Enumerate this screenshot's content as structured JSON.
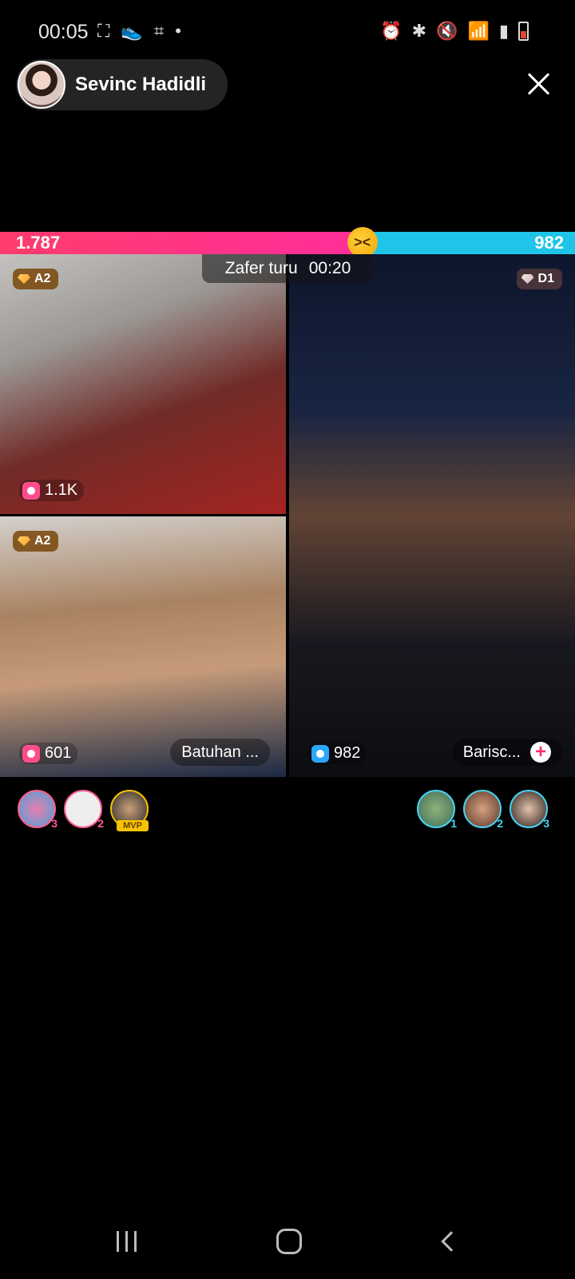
{
  "status_bar": {
    "time": "00:05",
    "left_icons": [
      "screenshot-icon",
      "shoe-icon",
      "scan-icon",
      "dot-icon"
    ],
    "right_icons": [
      "alarm-icon",
      "bluetooth-icon",
      "mute-icon",
      "wifi-icon",
      "signal-icon",
      "battery-icon"
    ]
  },
  "host": {
    "name": "Sevinc Hadidli"
  },
  "battle": {
    "left_score": "1.787",
    "right_score": "982",
    "left_share": 0.63,
    "round_label": "Zafer turu",
    "round_timer": "00:20"
  },
  "tiles": {
    "top_left": {
      "rank": "A2",
      "score": "1.1K"
    },
    "bottom_left": {
      "rank": "A2",
      "score": "601",
      "name": "Batuhan ..."
    },
    "right": {
      "rank": "D1",
      "score": "982",
      "name": "Barisc..."
    }
  },
  "supporters": {
    "left": [
      {
        "rank": "3"
      },
      {
        "rank": "2"
      },
      {
        "badge": "MVP"
      }
    ],
    "right": [
      {
        "rank": "1"
      },
      {
        "rank": "2"
      },
      {
        "rank": "3"
      }
    ]
  },
  "colors": {
    "left_team": "#ff2e9a",
    "right_team": "#1ec5e8"
  }
}
